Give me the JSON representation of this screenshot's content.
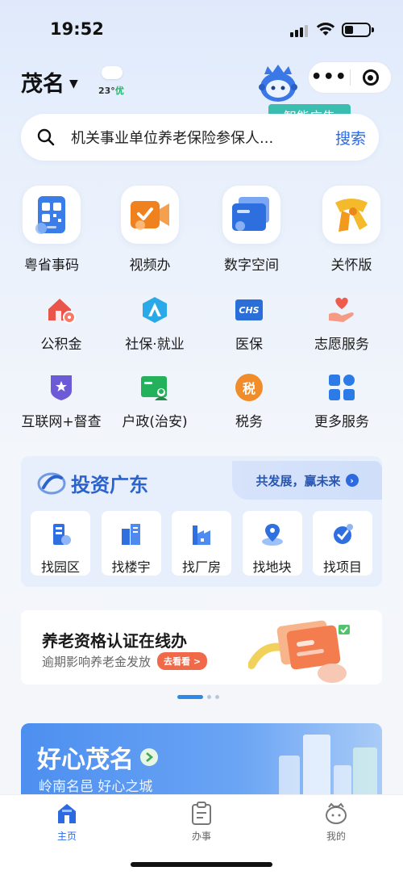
{
  "status_bar": {
    "time": "19:52"
  },
  "header": {
    "city": "茂名",
    "weather": {
      "temp": "23°",
      "aqi": "优"
    },
    "ad_tag": "智能广告"
  },
  "search": {
    "placeholder": "机关事业单位养老保险参保人...",
    "button": "搜索"
  },
  "main_services": [
    {
      "label": "粤省事码",
      "icon": "qr-code-icon"
    },
    {
      "label": "视频办",
      "icon": "video-camera-icon"
    },
    {
      "label": "数字空间",
      "icon": "folder-icon"
    },
    {
      "label": "关怀版",
      "icon": "scarf-icon"
    }
  ],
  "services_row1": [
    {
      "label": "公积金",
      "icon": "house-coin-icon"
    },
    {
      "label": "社保·就业",
      "icon": "social-security-icon"
    },
    {
      "label": "医保",
      "icon": "chs-icon",
      "icon_text": "CHS"
    },
    {
      "label": "志愿服务",
      "icon": "heart-hand-icon"
    }
  ],
  "services_row2": [
    {
      "label": "互联网+督查",
      "icon": "shield-star-icon"
    },
    {
      "label": "户政(治安)",
      "icon": "id-card-icon"
    },
    {
      "label": "税务",
      "icon": "tax-icon",
      "icon_text": "税"
    },
    {
      "label": "更多服务",
      "icon": "grid-icon"
    }
  ],
  "invest": {
    "title": "投资广东",
    "slogan": "共发展，赢未来",
    "items": [
      {
        "label": "找园区",
        "icon": "park-icon"
      },
      {
        "label": "找楼宇",
        "icon": "building-icon"
      },
      {
        "label": "找厂房",
        "icon": "factory-icon"
      },
      {
        "label": "找地块",
        "icon": "land-pin-icon"
      },
      {
        "label": "找项目",
        "icon": "project-icon"
      }
    ]
  },
  "banner": {
    "title": "养老资格认证在线办",
    "subtitle": "逾期影响养老金发放",
    "cta": "去看看 >"
  },
  "city_card": {
    "title": "好心茂名",
    "subtitle": "岭南名邑 好心之城"
  },
  "tabbar": [
    {
      "label": "主页",
      "icon": "home-icon",
      "active": true
    },
    {
      "label": "办事",
      "icon": "clipboard-icon",
      "active": false
    },
    {
      "label": "我的",
      "icon": "profile-icon",
      "active": false
    }
  ],
  "colors": {
    "accent": "#2d6ae0",
    "ad_tag": "#3bbdb0"
  }
}
